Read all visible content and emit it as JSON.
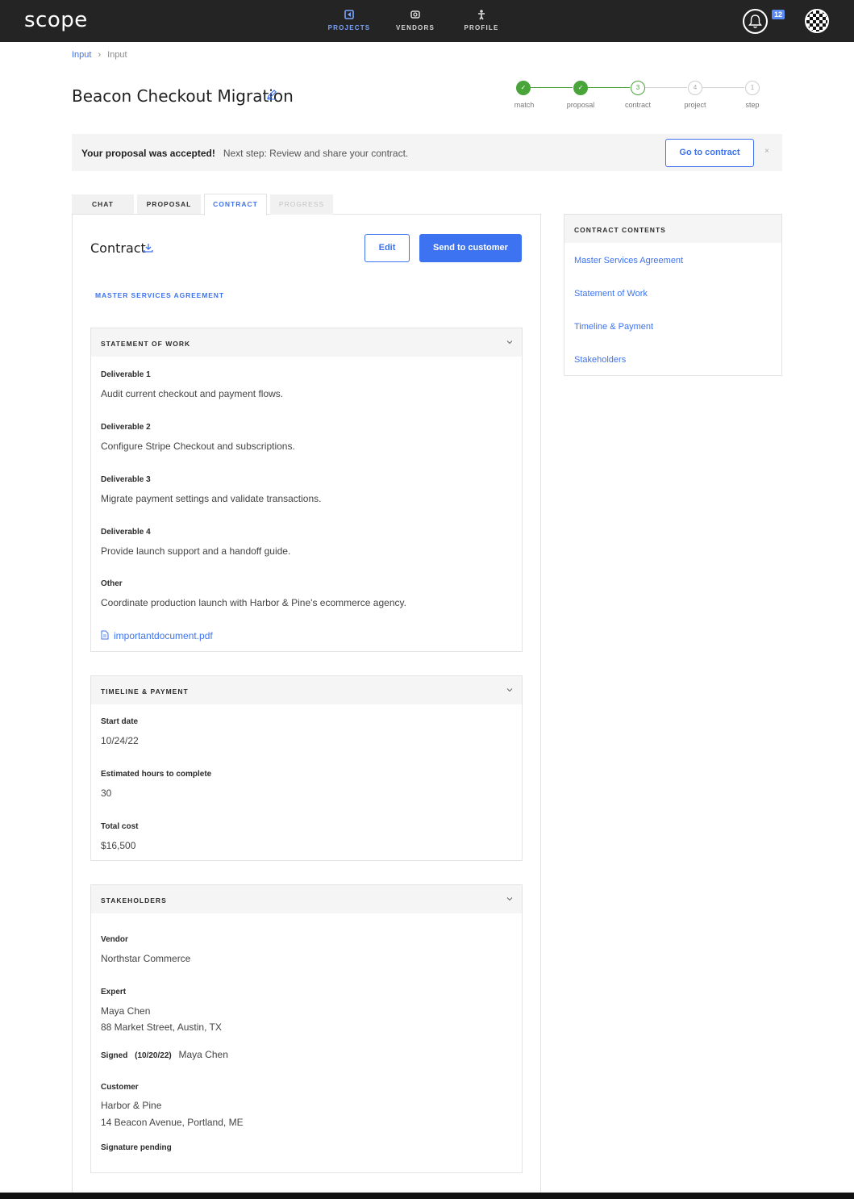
{
  "app": {
    "logo": "scope"
  },
  "nav": {
    "projects": "PROJECTS",
    "vendors": "VENDORS",
    "profile": "PROFILE",
    "notification_count": "12"
  },
  "breadcrumb": {
    "first": "Input",
    "second": "Input"
  },
  "page": {
    "title": "Beacon Checkout Migration"
  },
  "stepper": [
    {
      "label": "match",
      "mark": "✓",
      "state": "done"
    },
    {
      "label": "proposal",
      "mark": "✓",
      "state": "done"
    },
    {
      "label": "contract",
      "mark": "3",
      "state": "current"
    },
    {
      "label": "project",
      "mark": "4",
      "state": "todo"
    },
    {
      "label": "step",
      "mark": "1",
      "state": "todo"
    }
  ],
  "banner": {
    "bold": "Your proposal was accepted!",
    "text": "Next step: Review and share your contract.",
    "button": "Go to contract",
    "close": "×"
  },
  "tabs": {
    "chat": "CHAT",
    "proposal": "PROPOSAL",
    "contract": "CONTRACT",
    "progress": "PROGRESS"
  },
  "contract": {
    "title": "Contract",
    "edit": "Edit",
    "send": "Send to customer",
    "msa_link": "MASTER SERVICES AGREEMENT"
  },
  "sow": {
    "heading": "STATEMENT OF WORK",
    "items": [
      {
        "label": "Deliverable 1",
        "value": "Audit current checkout and payment flows."
      },
      {
        "label": "Deliverable 2",
        "value": "Configure Stripe Checkout and subscriptions."
      },
      {
        "label": "Deliverable 3",
        "value": "Migrate payment settings and validate transactions."
      },
      {
        "label": "Deliverable 4",
        "value": "Provide launch support and a handoff guide."
      },
      {
        "label": "Other",
        "value": "Coordinate production launch with Harbor & Pine's ecommerce agency."
      }
    ],
    "attachment": "importantdocument.pdf"
  },
  "timeline": {
    "heading": "TIMELINE & PAYMENT",
    "start_label": "Start date",
    "start_value": "10/24/22",
    "hours_label": "Estimated hours to complete",
    "hours_value": "30",
    "cost_label": "Total cost",
    "cost_value": "$16,500"
  },
  "stakeholders": {
    "heading": "STAKEHOLDERS",
    "vendor_label": "Vendor",
    "vendor_value": "Northstar Commerce",
    "expert_label": "Expert",
    "expert_name": "Maya Chen",
    "expert_address": "88 Market Street, Austin, TX",
    "signed_label": "Signed",
    "signed_date": "(10/20/22)",
    "signed_name": "Maya Chen",
    "customer_label": "Customer",
    "customer_name": "Harbor & Pine",
    "customer_address": "14 Beacon Avenue, Portland, ME",
    "signature_pending": "Signature pending"
  },
  "side": {
    "heading": "CONTRACT CONTENTS",
    "items": [
      "Master Services Agreement",
      "Statement of Work",
      "Timeline & Payment",
      "Stakeholders"
    ]
  }
}
